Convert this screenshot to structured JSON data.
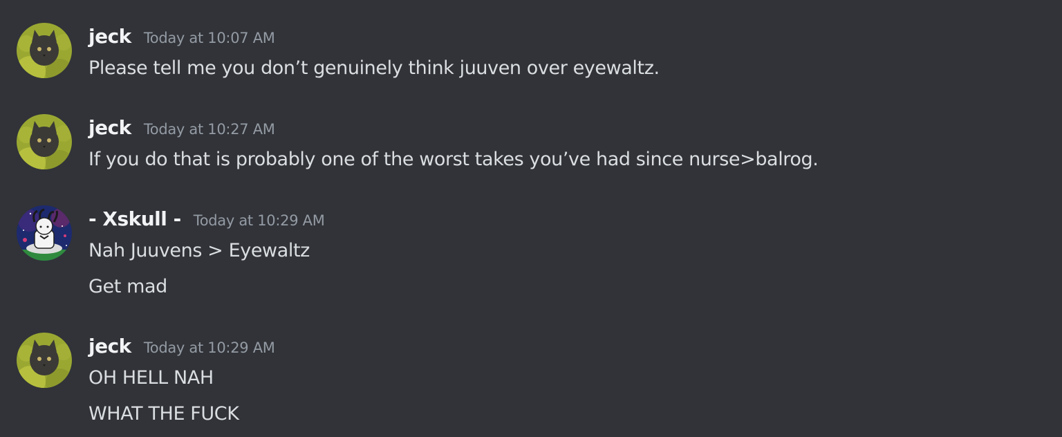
{
  "messages": [
    {
      "username": "jeck",
      "timestamp": "Today at 10:07 AM",
      "avatar": "cat-avatar-icon",
      "lines": [
        "Please tell me you don’t genuinely think juuven over eyewaltz."
      ]
    },
    {
      "username": "jeck",
      "timestamp": "Today at 10:27 AM",
      "avatar": "cat-avatar-icon",
      "lines": [
        "If you do that is probably one of the worst takes you’ve had since nurse>balrog."
      ]
    },
    {
      "username": "- Xskull -",
      "timestamp": "Today at 10:29 AM",
      "avatar": "space-character-avatar-icon",
      "lines": [
        "Nah Juuvens > Eyewaltz",
        "Get mad"
      ]
    },
    {
      "username": "jeck",
      "timestamp": "Today at 10:29 AM",
      "avatar": "cat-avatar-icon",
      "lines": [
        "OH HELL NAH",
        "WHAT THE FUCK"
      ]
    }
  ],
  "colors": {
    "background": "#313338",
    "username": "#f2f3f5",
    "timestamp": "#949ba4",
    "text": "#dbdee1"
  }
}
